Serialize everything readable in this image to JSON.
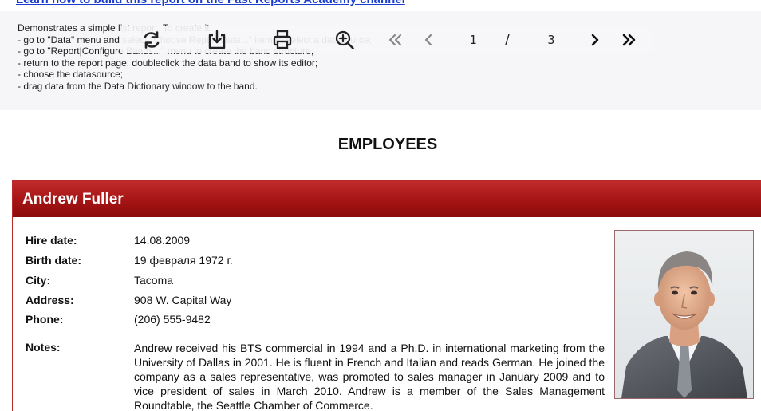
{
  "report": {
    "academy_link": "Learn how to build this report on the Fast Reports Academy channel",
    "description": [
      "Demonstrates a simple list report. To create it:",
      "- go to \"Data\" menu and select \"Choose Report Data...\" item to select a datasource;",
      "- go to \"Report|Configure Bands...\" menu to create the band structure;",
      "- return to the report page, doubleclick the data band to show its editor;",
      "- choose the datasource;",
      "- drag data from the Data Dictionary window to the band."
    ],
    "title": "EMPLOYEES"
  },
  "toolbar": {
    "icons": [
      "refresh-icon",
      "download-icon",
      "print-icon",
      "zoom-in-icon",
      "first-page-icon",
      "prev-page-icon",
      "next-page-icon",
      "last-page-icon"
    ],
    "current_page": "1",
    "separator": "/",
    "total_pages": "3"
  },
  "employee": {
    "name": "Andrew Fuller",
    "fields": [
      {
        "label": "Hire date:",
        "value": "14.08.2009"
      },
      {
        "label": "Birth date:",
        "value": "19 февраля 1972 г."
      },
      {
        "label": "City:",
        "value": "Tacoma"
      },
      {
        "label": "Address:",
        "value": "908 W. Capital Way"
      },
      {
        "label": "Phone:",
        "value": "(206) 555-9482"
      }
    ],
    "notes_label": "Notes:",
    "notes": "Andrew received his BTS commercial in 1994 and a Ph.D. in international marketing from the University of Dallas in 2001.  He is fluent in French and Italian and reads German.  He joined the company as a sales representative, was promoted to sales manager in January 2009 and to vice president of sales in March 2010.  Andrew is a member of the Sales Management Roundtable, the Seattle Chamber of Commerce."
  },
  "colors": {
    "header_red": "#a51414",
    "link_blue": "#1a3ccf",
    "panel_gray": "#f6f6f8"
  }
}
